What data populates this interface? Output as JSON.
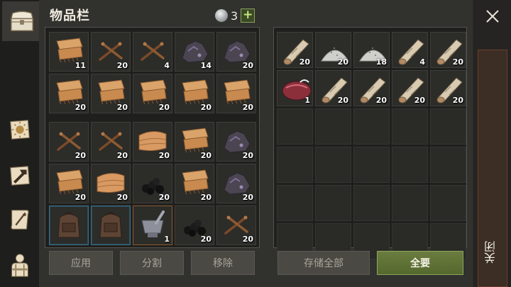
{
  "header": {
    "title": "物品栏",
    "currency_count": "3",
    "add_label": "+"
  },
  "sidebar": {
    "tabs": [
      {
        "name": "inventory-tab",
        "icon": "chest-icon",
        "active": true
      },
      {
        "name": "crafting-tab",
        "icon": "sun-scroll-icon",
        "active": false
      },
      {
        "name": "building-tab",
        "icon": "hammer-icon",
        "active": false
      },
      {
        "name": "recipes-tab",
        "icon": "quill-scroll-icon",
        "active": false
      },
      {
        "name": "character-tab",
        "icon": "character-icon",
        "active": false
      }
    ]
  },
  "bag_top": [
    {
      "item": "cloth",
      "count": "11"
    },
    {
      "item": "sticks",
      "count": "20"
    },
    {
      "item": "sticks",
      "count": "4"
    },
    {
      "item": "ore",
      "count": "14"
    },
    {
      "item": "ore",
      "count": "20"
    },
    {
      "item": "cloth",
      "count": "20"
    },
    {
      "item": "cloth",
      "count": "20"
    },
    {
      "item": "cloth",
      "count": "20"
    },
    {
      "item": "cloth",
      "count": "20"
    },
    {
      "item": "cloth",
      "count": "20"
    }
  ],
  "bag_bottom": [
    {
      "item": "sticks",
      "count": "20"
    },
    {
      "item": "sticks",
      "count": "20"
    },
    {
      "item": "fabric",
      "count": "20"
    },
    {
      "item": "cloth",
      "count": "20"
    },
    {
      "item": "ore",
      "count": "20"
    },
    {
      "item": "cloth",
      "count": "20"
    },
    {
      "item": "fabric",
      "count": "20"
    },
    {
      "item": "coal",
      "count": "20"
    },
    {
      "item": "cloth",
      "count": "20"
    },
    {
      "item": "ore",
      "count": "20"
    },
    {
      "item": "backpack",
      "count": "",
      "style": "hl"
    },
    {
      "item": "backpack",
      "count": "",
      "style": "hl"
    },
    {
      "item": "mortar",
      "count": "1",
      "style": "hl-orange"
    },
    {
      "item": "coal",
      "count": "20"
    },
    {
      "item": "sticks",
      "count": "20"
    }
  ],
  "storage": [
    {
      "item": "log",
      "count": "20"
    },
    {
      "item": "powder",
      "count": "20"
    },
    {
      "item": "powder",
      "count": "18"
    },
    {
      "item": "log",
      "count": "4"
    },
    {
      "item": "log",
      "count": "20"
    },
    {
      "item": "meat",
      "count": "1"
    },
    {
      "item": "log",
      "count": "20"
    },
    {
      "item": "log",
      "count": "20"
    },
    {
      "item": "log",
      "count": "20"
    },
    {
      "item": "log",
      "count": "20"
    },
    {
      "item": "",
      "count": ""
    },
    {
      "item": "",
      "count": ""
    },
    {
      "item": "",
      "count": ""
    },
    {
      "item": "",
      "count": ""
    },
    {
      "item": "",
      "count": ""
    },
    {
      "item": "",
      "count": ""
    },
    {
      "item": "",
      "count": ""
    },
    {
      "item": "",
      "count": ""
    },
    {
      "item": "",
      "count": ""
    },
    {
      "item": "",
      "count": ""
    },
    {
      "item": "",
      "count": ""
    },
    {
      "item": "",
      "count": ""
    },
    {
      "item": "",
      "count": ""
    },
    {
      "item": "",
      "count": ""
    },
    {
      "item": "",
      "count": ""
    },
    {
      "item": "",
      "count": ""
    },
    {
      "item": "",
      "count": ""
    },
    {
      "item": "",
      "count": ""
    },
    {
      "item": "",
      "count": ""
    },
    {
      "item": "",
      "count": ""
    }
  ],
  "buttons": {
    "apply": "应用",
    "split": "分割",
    "remove": "移除",
    "store_all": "存储全部",
    "take_all": "全要"
  },
  "close_label": "关闭",
  "colors": {
    "accent_green": "#8ea55a",
    "slot_bg": "#2c2c29",
    "panel_bg": "#1f1f1d",
    "close_strip": "#3c2d25"
  }
}
